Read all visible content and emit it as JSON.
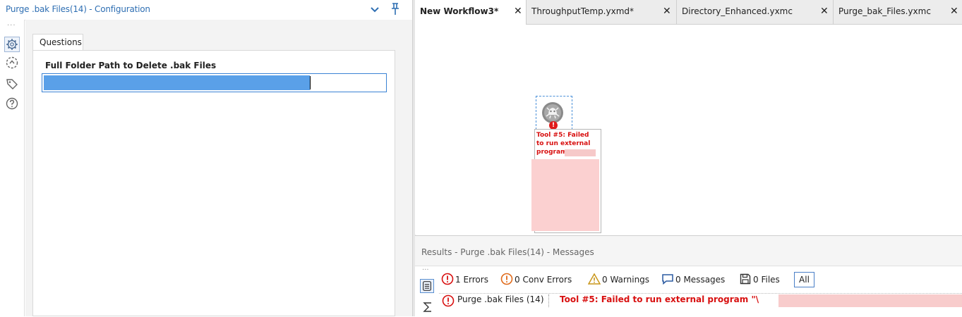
{
  "config": {
    "title": "Purge .bak Files(14) - Configuration",
    "tab_label": "Questions",
    "field_label": "Full Folder Path to Delete .bak Files",
    "field_value": ""
  },
  "tabs": [
    {
      "label": "New Workflow3*",
      "active": true
    },
    {
      "label": "ThroughputTemp.yxmd*",
      "active": false
    },
    {
      "label": "Directory_Enhanced.yxmc",
      "active": false
    },
    {
      "label": "Purge_bak_Files.yxmc",
      "active": false
    }
  ],
  "canvas": {
    "tool_annotation": "Tool #5: Failed to run external program"
  },
  "results": {
    "title": "Results - Purge .bak Files(14) - Messages",
    "filters": {
      "errors": "1 Errors",
      "conv_errors": "0 Conv Errors",
      "warnings": "0 Warnings",
      "messages": "0 Messages",
      "files": "0 Files",
      "all": "All"
    },
    "message": {
      "tool": "Purge .bak Files (14)",
      "text": "Tool #5: Failed to run external program \"\\"
    }
  },
  "colors": {
    "accent": "#2f6fb3",
    "error": "#d81010",
    "selection": "#5aa0e8"
  }
}
